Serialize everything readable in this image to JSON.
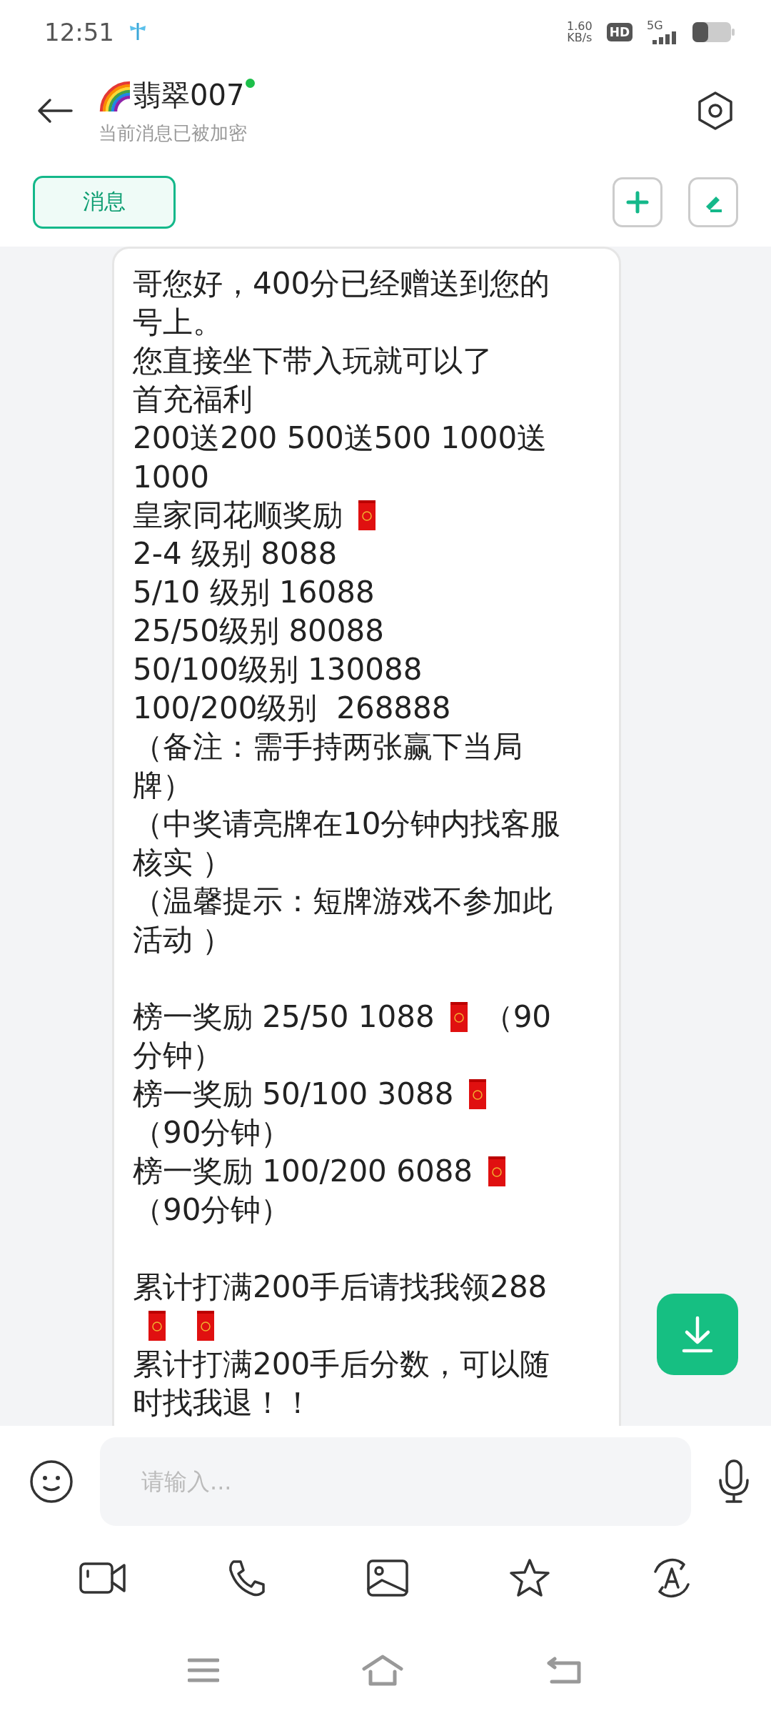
{
  "status_bar": {
    "time": "12:51",
    "net_speed": "1.60",
    "net_unit": "KB/s",
    "hd": "HD",
    "network": "5G"
  },
  "header": {
    "title": "翡翠007",
    "online": true,
    "subtitle": "当前消息已被加密"
  },
  "tabs": [
    {
      "label": "消息",
      "selected": true
    }
  ],
  "message": {
    "lines": [
      {
        "kind": "text",
        "parts": [
          {
            "kind": "text",
            "text": "哥您好，400分已经赠送到您的"
          }
        ]
      },
      {
        "kind": "text",
        "parts": [
          {
            "kind": "text",
            "text": "号上。"
          }
        ]
      },
      {
        "kind": "text",
        "parts": [
          {
            "kind": "text",
            "text": "您直接坐下带入玩就可以了"
          }
        ]
      },
      {
        "kind": "text",
        "parts": [
          {
            "kind": "text",
            "text": "首充福利"
          }
        ]
      },
      {
        "kind": "text",
        "parts": [
          {
            "kind": "text",
            "text": "200送200 500送500 1000送"
          }
        ]
      },
      {
        "kind": "text",
        "parts": [
          {
            "kind": "text",
            "text": "1000"
          }
        ]
      },
      {
        "kind": "text",
        "parts": [
          {
            "kind": "text",
            "text": "皇家同花顺奖励"
          },
          {
            "kind": "envelope"
          }
        ]
      },
      {
        "kind": "text",
        "parts": [
          {
            "kind": "text",
            "text": "2-4 级别 8088"
          }
        ]
      },
      {
        "kind": "text",
        "parts": [
          {
            "kind": "text",
            "text": "5/10 级别 16088"
          }
        ]
      },
      {
        "kind": "text",
        "parts": [
          {
            "kind": "text",
            "text": "25/50级别 80088"
          }
        ]
      },
      {
        "kind": "text",
        "parts": [
          {
            "kind": "text",
            "text": "50/100级别 130088"
          }
        ]
      },
      {
        "kind": "text",
        "parts": [
          {
            "kind": "text",
            "text": "100/200级别  268888"
          }
        ]
      },
      {
        "kind": "text",
        "parts": [
          {
            "kind": "text",
            "text": "（备注：需手持两张赢下当局"
          }
        ]
      },
      {
        "kind": "text",
        "parts": [
          {
            "kind": "text",
            "text": "牌）"
          }
        ]
      },
      {
        "kind": "text",
        "parts": [
          {
            "kind": "text",
            "text": "（中奖请亮牌在10分钟内找客服"
          }
        ]
      },
      {
        "kind": "text",
        "parts": [
          {
            "kind": "text",
            "text": "核实 ）"
          }
        ]
      },
      {
        "kind": "text",
        "parts": [
          {
            "kind": "text",
            "text": "（温馨提示：短牌游戏不参加此"
          }
        ]
      },
      {
        "kind": "text",
        "parts": [
          {
            "kind": "text",
            "text": "活动 ）"
          }
        ]
      },
      {
        "kind": "gap"
      },
      {
        "kind": "text",
        "parts": [
          {
            "kind": "text",
            "text": "榜一奖励 25/50 1088"
          },
          {
            "kind": "envelope"
          },
          {
            "kind": "text",
            "text": "（90"
          }
        ]
      },
      {
        "kind": "text",
        "parts": [
          {
            "kind": "text",
            "text": "分钟）"
          }
        ]
      },
      {
        "kind": "text",
        "parts": [
          {
            "kind": "text",
            "text": "榜一奖励 50/100 3088"
          },
          {
            "kind": "envelope"
          }
        ]
      },
      {
        "kind": "text",
        "parts": [
          {
            "kind": "text",
            "text": "（90分钟）"
          }
        ]
      },
      {
        "kind": "text",
        "parts": [
          {
            "kind": "text",
            "text": "榜一奖励 100/200 6088"
          },
          {
            "kind": "envelope"
          }
        ]
      },
      {
        "kind": "text",
        "parts": [
          {
            "kind": "text",
            "text": "（90分钟）"
          }
        ]
      },
      {
        "kind": "gap"
      },
      {
        "kind": "text",
        "parts": [
          {
            "kind": "text",
            "text": "累计打满200手后请找我领288"
          }
        ]
      },
      {
        "kind": "text",
        "parts": [
          {
            "kind": "envelope"
          },
          {
            "kind": "envelope"
          }
        ]
      },
      {
        "kind": "text",
        "parts": [
          {
            "kind": "text",
            "text": "累计打满200手后分数，可以随"
          }
        ]
      },
      {
        "kind": "text",
        "parts": [
          {
            "kind": "text",
            "text": "时找我退！！"
          }
        ]
      }
    ]
  },
  "input": {
    "placeholder": "请输入..."
  }
}
